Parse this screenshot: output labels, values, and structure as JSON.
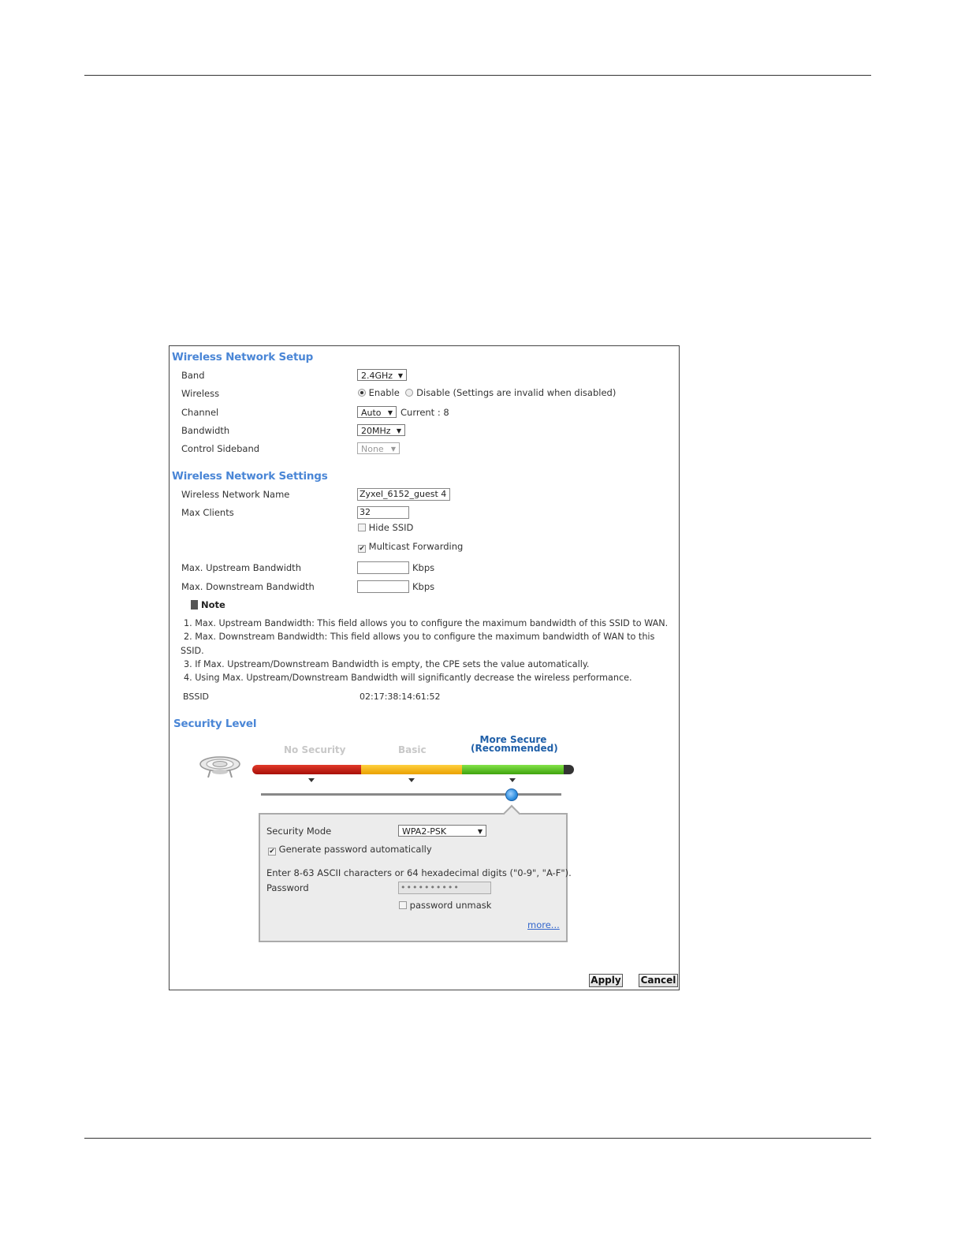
{
  "wireless_setup": {
    "title": "Wireless Network Setup",
    "band_label": "Band",
    "band_value": "2.4GHz",
    "wireless_label": "Wireless",
    "enable_label": "Enable",
    "disable_label": "Disable (Settings are invalid when disabled)",
    "channel_label": "Channel",
    "channel_value": "Auto",
    "current_label": "Current",
    "current_value": ": 8",
    "bandwidth_label": "Bandwidth",
    "bandwidth_value": "20MHz",
    "sideband_label": "Control Sideband",
    "sideband_value": "None"
  },
  "wireless_settings": {
    "title": "Wireless Network Settings",
    "name_label": "Wireless Network Name",
    "name_value": "Zyxel_6152_guest 4",
    "max_clients_label": "Max Clients",
    "max_clients_value": "32",
    "hide_ssid_label": "Hide SSID",
    "hide_ssid_checked": false,
    "multicast_label": "Multicast Forwarding",
    "multicast_checked": true,
    "upstream_label": "Max. Upstream Bandwidth",
    "upstream_value": "",
    "downstream_label": "Max. Downstream Bandwidth",
    "downstream_value": "",
    "unit": "Kbps",
    "note_title": "Note",
    "notes": [
      "1. Max. Upstream Bandwidth: This field allows you to configure the maximum bandwidth of this SSID to WAN.",
      "2. Max. Downstream Bandwidth: This field allows you to configure the maximum bandwidth of WAN to this",
      "SSID.",
      "3. If Max. Upstream/Downstream Bandwidth is empty, the CPE sets the value automatically.",
      "4. Using Max. Upstream/Downstream Bandwidth will significantly decrease the wireless performance."
    ],
    "bssid_label": "BSSID",
    "bssid_value": "02:17:38:14:61:52"
  },
  "security": {
    "title": "Security Level",
    "levels": [
      "No Security",
      "Basic",
      "More Secure",
      "(Recommended)"
    ],
    "bar_colors": {
      "low": "#c81e12",
      "mid": "#f5b60f",
      "high": "#5cc21e",
      "accent": "#2f8fe0"
    },
    "mode_label": "Security Mode",
    "mode_value": "WPA2-PSK",
    "generate_label": "Generate password automatically",
    "generate_checked": true,
    "hint": "Enter 8-63 ASCII characters or 64 hexadecimal digits (\"0-9\", \"A-F\").",
    "password_label": "Password",
    "password_value": "••••••••••",
    "unmask_label": "password unmask",
    "more_label": "more..."
  },
  "buttons": {
    "apply": "Apply",
    "cancel": "Cancel"
  }
}
